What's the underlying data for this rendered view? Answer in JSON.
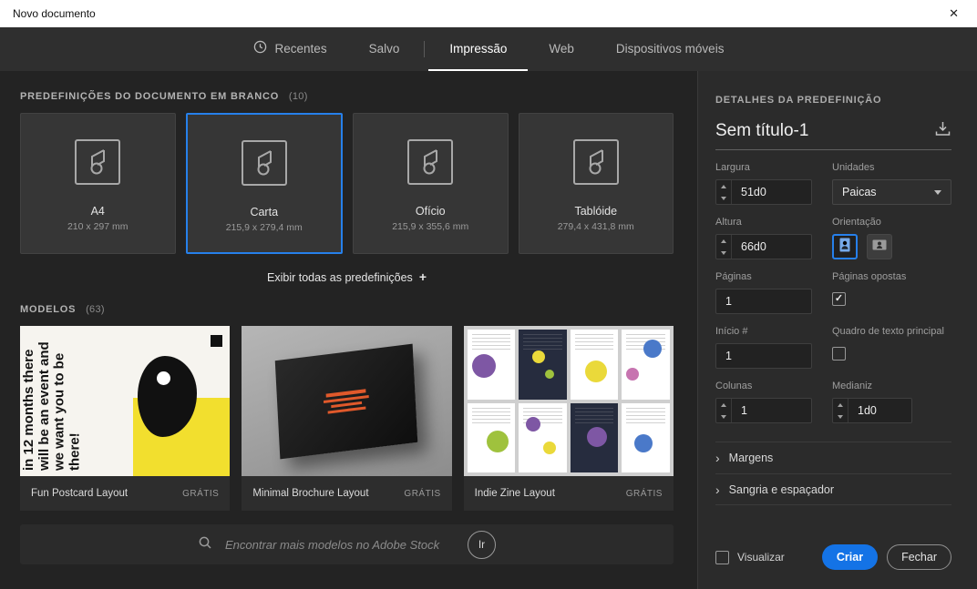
{
  "window": {
    "title": "Novo documento",
    "close_label": "✕"
  },
  "tabs": {
    "items": [
      {
        "label": "Recentes"
      },
      {
        "label": "Salvo"
      },
      {
        "label": "Impressão"
      },
      {
        "label": "Web"
      },
      {
        "label": "Dispositivos móveis"
      }
    ],
    "active": "Impressão"
  },
  "presets": {
    "title": "PREDEFINIÇÕES DO DOCUMENTO EM BRANCO",
    "count": "(10)",
    "items": [
      {
        "name": "A4",
        "size": "210 x 297 mm"
      },
      {
        "name": "Carta",
        "size": "215,9 x 279,4 mm"
      },
      {
        "name": "Ofício",
        "size": "215,9 x 355,6 mm"
      },
      {
        "name": "Tablóide",
        "size": "279,4 x 431,8 mm"
      }
    ],
    "selected": "Carta",
    "show_all_label": "Exibir todas as predefinições",
    "show_all_plus": "+"
  },
  "templates": {
    "title": "MODELOS",
    "count": "(63)",
    "items": [
      {
        "name": "Fun Postcard Layout",
        "badge": "GRÁTIS",
        "thumb_text": "in 12 months there will be an event and we want you to be there!"
      },
      {
        "name": "Minimal Brochure Layout",
        "badge": "GRÁTIS"
      },
      {
        "name": "Indie Zine Layout",
        "badge": "GRÁTIS"
      }
    ],
    "search": {
      "placeholder": "Encontrar mais modelos no Adobe Stock",
      "go_label": "Ir"
    }
  },
  "details": {
    "title": "DETALHES DA PREDEFINIÇÃO",
    "doc_name": "Sem título-1",
    "largura": {
      "label": "Largura",
      "value": "51d0"
    },
    "unidades": {
      "label": "Unidades",
      "value": "Paicas"
    },
    "altura": {
      "label": "Altura",
      "value": "66d0"
    },
    "orientacao": {
      "label": "Orientação",
      "selected": "portrait"
    },
    "paginas": {
      "label": "Páginas",
      "value": "1"
    },
    "paginas_opostas": {
      "label": "Páginas opostas",
      "checked": true
    },
    "inicio": {
      "label": "Início #",
      "value": "1"
    },
    "quadro_texto": {
      "label": "Quadro de texto principal",
      "checked": false
    },
    "colunas": {
      "label": "Colunas",
      "value": "1"
    },
    "medianiz": {
      "label": "Medianiz",
      "value": "1d0"
    },
    "sections": [
      {
        "label": "Margens"
      },
      {
        "label": "Sangria e espaçador"
      }
    ],
    "visualizar_label": "Visualizar",
    "visualizar_checked": false,
    "criar_label": "Criar",
    "fechar_label": "Fechar"
  },
  "colors": {
    "accent": "#2680eb",
    "create_button": "#1473e6"
  }
}
